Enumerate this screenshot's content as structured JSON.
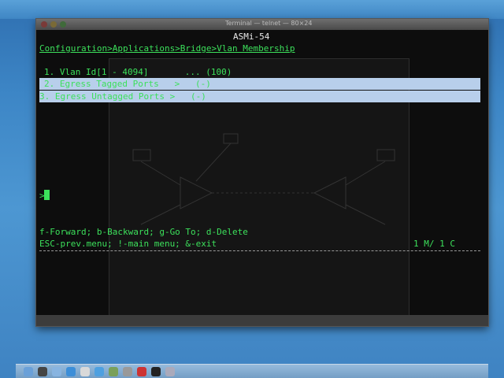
{
  "window": {
    "title": "Terminal — telnet — 80×24",
    "host_title": "ASMi-54"
  },
  "terminal": {
    "breadcrumb": "Configuration>Applications>Bridge>Vlan Membership",
    "menu_items": [
      {
        "label": "1. Vlan Id[1 - 4094]       ... (100)"
      },
      {
        "label": "2. Egress Tagged Ports   >   (-)"
      },
      {
        "label": "3. Egress Untagged Ports >   (-)"
      }
    ],
    "prompt": ">",
    "help_line_1": "f-Forward; b-Backward; g-Go To; d-Delete",
    "help_line_2": "ESC-prev.menu; !-main menu; &-exit",
    "page_indicator": "1 M/ 1 C"
  },
  "colors": {
    "terminal_text": "#3ce05b",
    "selection_bg": "#b8cfeb",
    "terminal_bg": "#0d0d0d",
    "desktop_bg": "#3d86c6"
  },
  "icons": {
    "dock": [
      "finder-icon",
      "dashboard-icon",
      "mail-icon",
      "safari-icon",
      "ical-icon",
      "itunes-icon",
      "iphoto-icon",
      "preferences-icon",
      "terminal-icon",
      "trash-icon"
    ]
  }
}
